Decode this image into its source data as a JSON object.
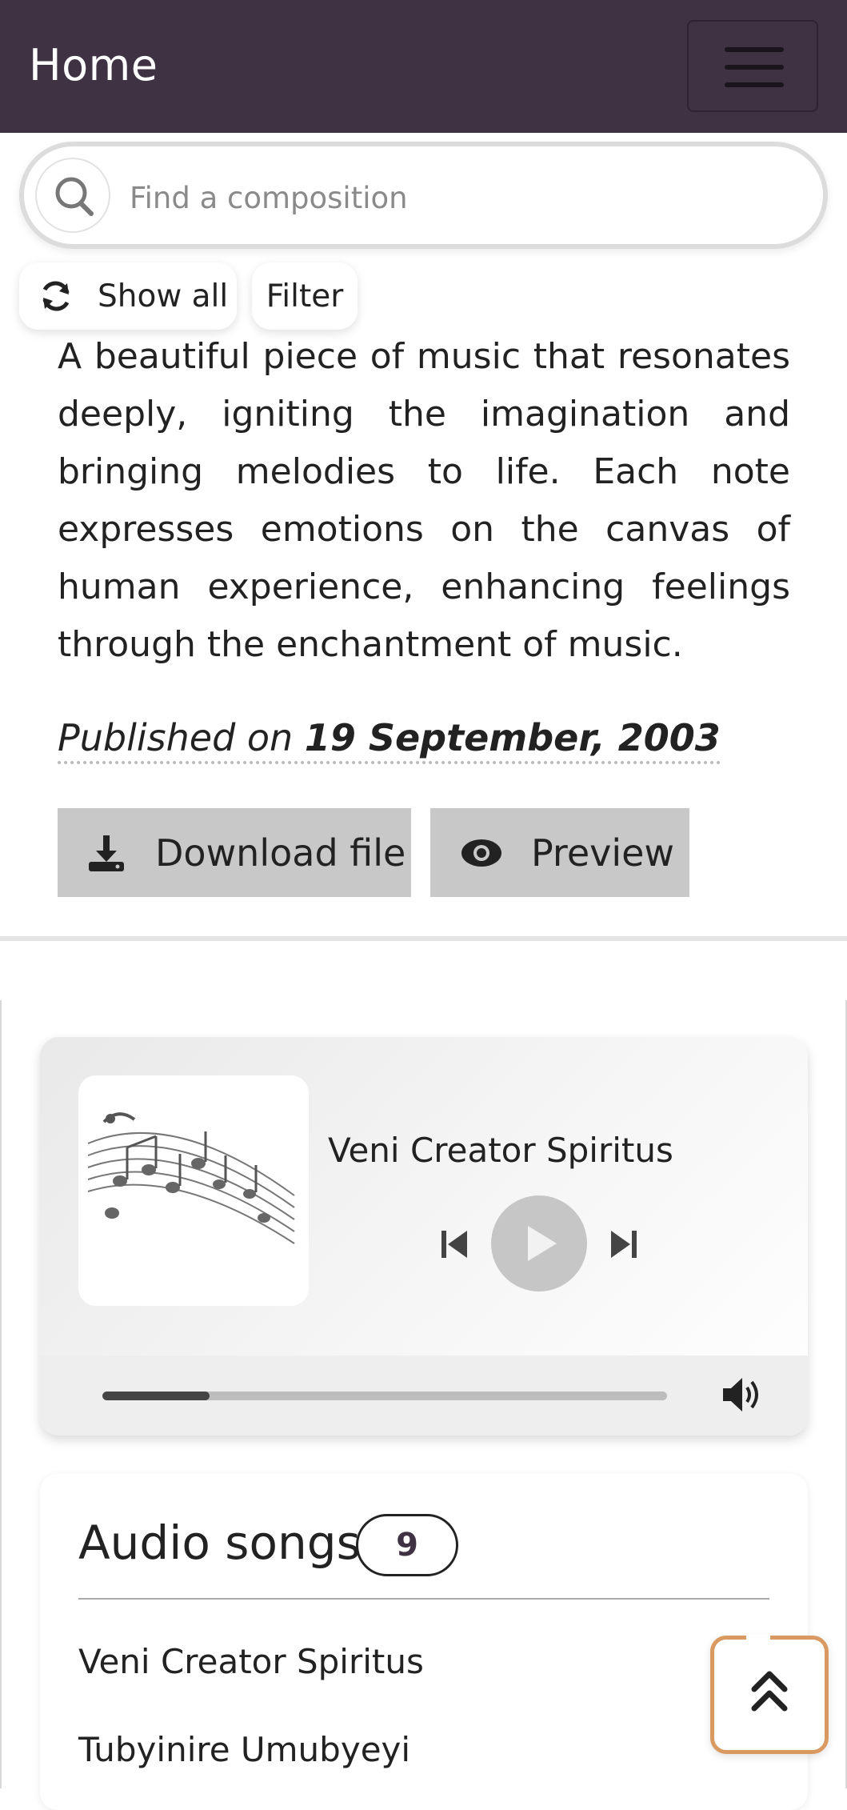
{
  "navbar": {
    "title": "Home"
  },
  "search": {
    "placeholder": "Find a composition"
  },
  "actions": {
    "show_all": "Show all",
    "filter": "Filter"
  },
  "composition": {
    "description": "A beautiful piece of music that resonates deeply, igniting the imagination and bringing melodies to life. Each note expresses emotions on the canvas of human experience, enhancing feelings through the enchantment of music.",
    "published_label": "Published on",
    "published_date": "19 September, 2003",
    "download_label": "Download file",
    "preview_label": "Preview"
  },
  "player": {
    "track_title": "Veni Creator Spiritus",
    "progress": 0.19
  },
  "songs": {
    "heading": "Audio songs",
    "count": "9",
    "items": [
      "Veni Creator Spiritus",
      "Tubyinire Umubyeyi"
    ]
  },
  "colors": {
    "navbar": "#3f3243",
    "button_bg": "#c8c8c8",
    "scroll_top_border": "#d99a62"
  }
}
